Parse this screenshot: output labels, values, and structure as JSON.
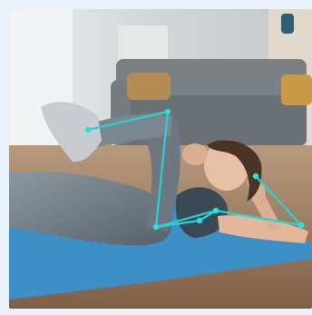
{
  "photo": {
    "subject": "pose-estimation-overlay",
    "skeleton_color": "#27d3d3",
    "joint_color": "#2fe0dc",
    "mat_color": "#3f8fc7",
    "floor_color": "#9a7a5e",
    "wall_color": "#cfd4d6",
    "sofa_color": "#6e7478",
    "legging_color": "#6c7780"
  }
}
